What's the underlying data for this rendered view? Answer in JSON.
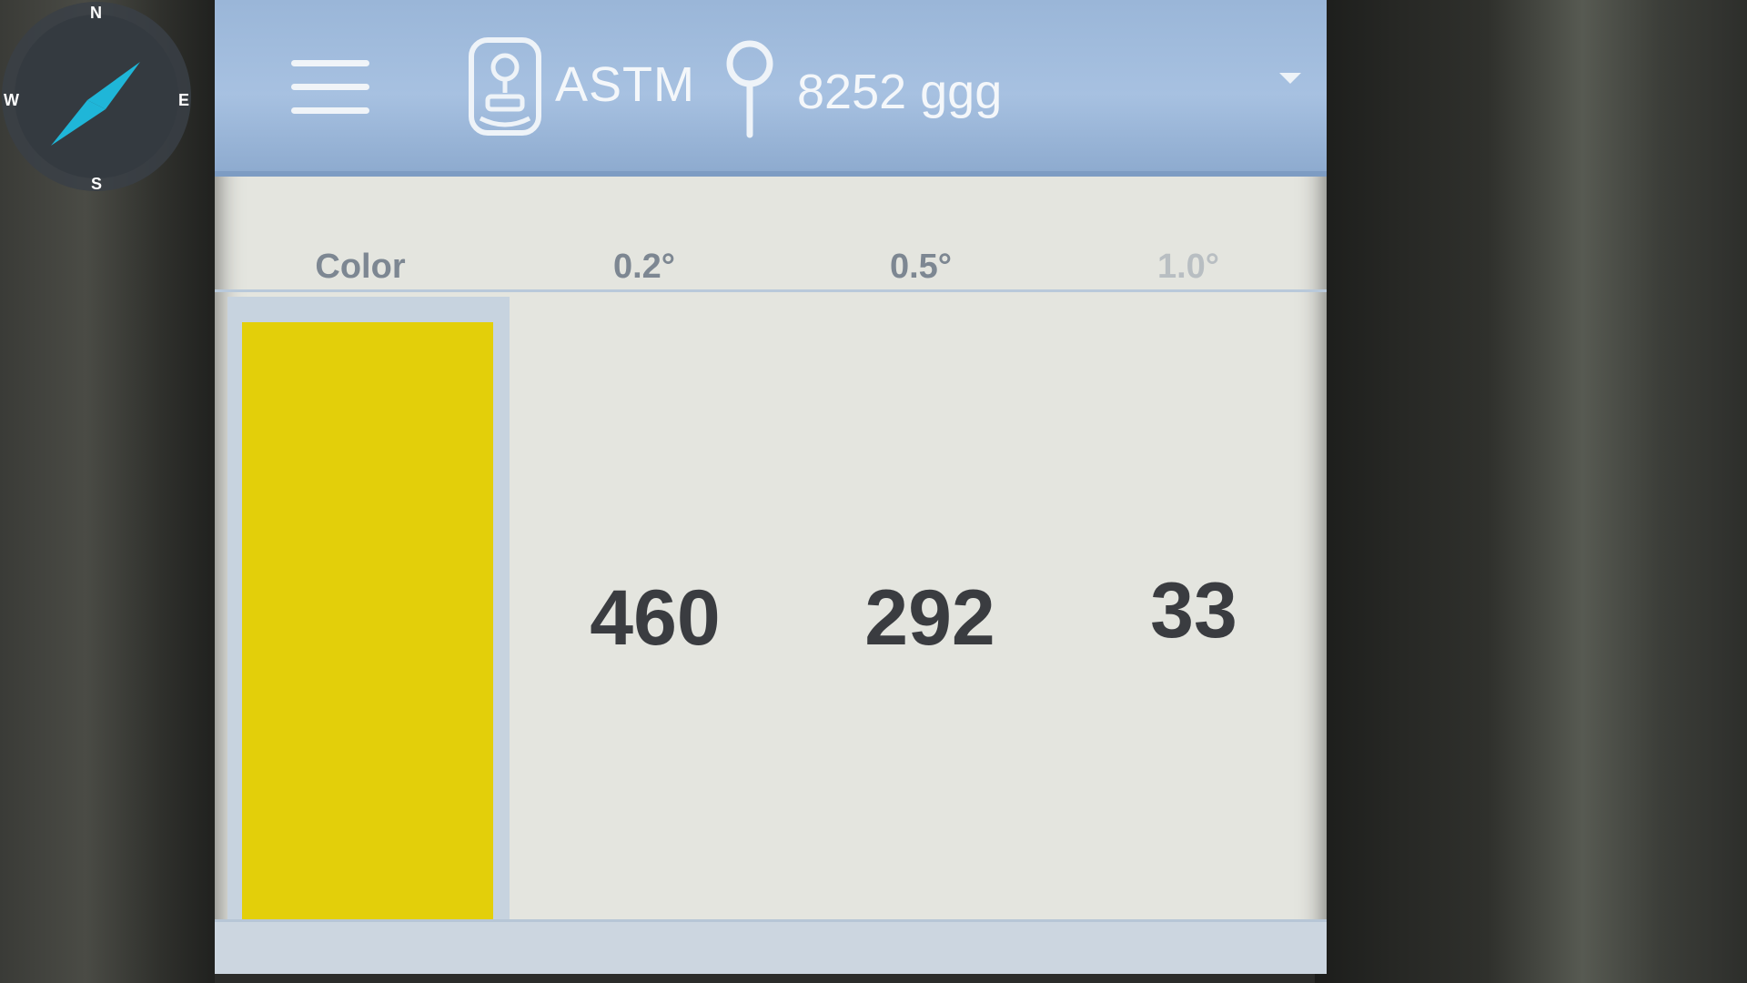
{
  "header": {
    "mode": "ASTM",
    "sample": "8252 ggg"
  },
  "table": {
    "headers": [
      "Color",
      "0.2°",
      "0.5°",
      "1.0°"
    ],
    "values": [
      "460",
      "292",
      "33"
    ],
    "swatch_color": "#e3cf0a"
  },
  "compass": {
    "north": "N",
    "south": "S",
    "east": "E",
    "west": "W",
    "needle_color": "#1fb6d8"
  }
}
